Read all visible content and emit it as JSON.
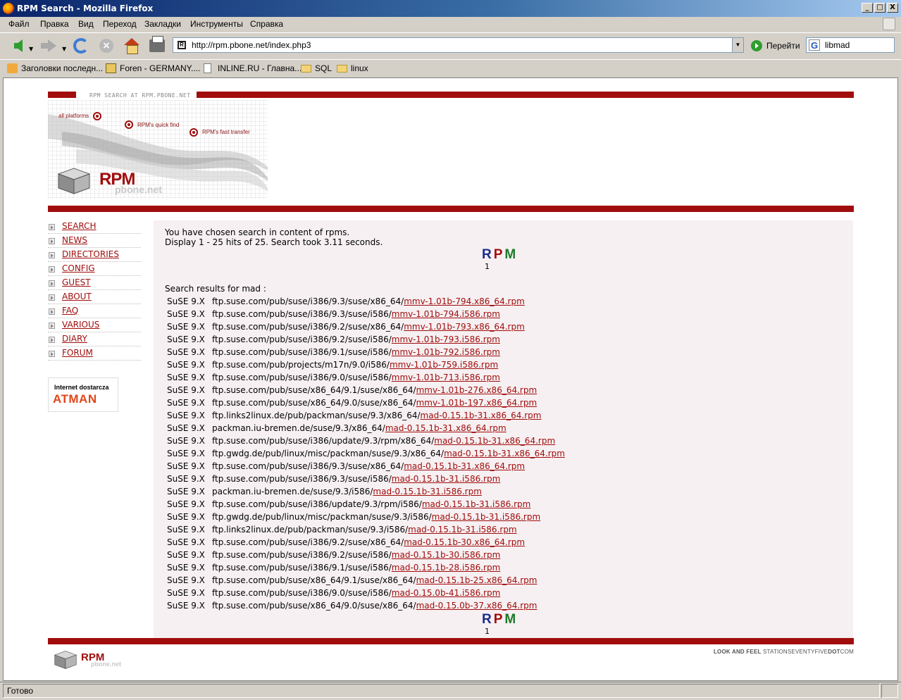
{
  "window": {
    "title": "RPM Search - Mozilla Firefox",
    "min": "_",
    "max": "□",
    "close": "X"
  },
  "menu": [
    "Файл",
    "Правка",
    "Вид",
    "Переход",
    "Закладки",
    "Инструменты",
    "Справка"
  ],
  "toolbar": {
    "url": "http://rpm.pbone.net/index.php3",
    "go_label": "Перейти",
    "search_value": "libmad"
  },
  "bookmarks": [
    {
      "label": "Заголовки последн...",
      "icon": "rss-icon"
    },
    {
      "label": "Foren - GERMANY....",
      "icon": "forum-icon"
    },
    {
      "label": "INLINE.RU - Главна...",
      "icon": "page-icon"
    },
    {
      "label": "SQL",
      "icon": "folder-icon"
    },
    {
      "label": "linux",
      "icon": "folder-icon"
    }
  ],
  "header": {
    "tagline": "RPM SEARCH AT RPM.PBONE.NET",
    "banner_labels": [
      "all platforms",
      "RPM's quick find",
      "RPM's fast transfer"
    ],
    "logo_rpm": "RPM",
    "logo_pbone": "pbone.net"
  },
  "nav": [
    "SEARCH",
    "NEWS",
    "DIRECTORIES",
    "CONFIG",
    "GUEST",
    "ABOUT",
    "FAQ",
    "VARIOUS",
    "DIARY",
    "FORUM"
  ],
  "sponsor": {
    "line1": "Internet dostarcza",
    "line2": "ATMAN"
  },
  "main": {
    "intro1": "You have chosen search in content of rpms.",
    "intro2": "Display 1 - 25 hits of 25. Search took 3.11 seconds.",
    "rpm_r": "R",
    "rpm_p": "P",
    "rpm_m": "M",
    "page": "1",
    "results_head": "Search results for mad :",
    "results": [
      {
        "dist": "SuSE 9.X",
        "path": "ftp.suse.com/pub/suse/i386/9.3/suse/x86_64/",
        "file": "mmv-1.01b-794.x86_64.rpm"
      },
      {
        "dist": "SuSE 9.X",
        "path": "ftp.suse.com/pub/suse/i386/9.3/suse/i586/",
        "file": "mmv-1.01b-794.i586.rpm"
      },
      {
        "dist": "SuSE 9.X",
        "path": "ftp.suse.com/pub/suse/i386/9.2/suse/x86_64/",
        "file": "mmv-1.01b-793.x86_64.rpm"
      },
      {
        "dist": "SuSE 9.X",
        "path": "ftp.suse.com/pub/suse/i386/9.2/suse/i586/",
        "file": "mmv-1.01b-793.i586.rpm"
      },
      {
        "dist": "SuSE 9.X",
        "path": "ftp.suse.com/pub/suse/i386/9.1/suse/i586/",
        "file": "mmv-1.01b-792.i586.rpm"
      },
      {
        "dist": "SuSE 9.X",
        "path": "ftp.suse.com/pub/projects/m17n/9.0/i586/",
        "file": "mmv-1.01b-759.i586.rpm"
      },
      {
        "dist": "SuSE 9.X",
        "path": "ftp.suse.com/pub/suse/i386/9.0/suse/i586/",
        "file": "mmv-1.01b-713.i586.rpm"
      },
      {
        "dist": "SuSE 9.X",
        "path": "ftp.suse.com/pub/suse/x86_64/9.1/suse/x86_64/",
        "file": "mmv-1.01b-276.x86_64.rpm"
      },
      {
        "dist": "SuSE 9.X",
        "path": "ftp.suse.com/pub/suse/x86_64/9.0/suse/x86_64/",
        "file": "mmv-1.01b-197.x86_64.rpm"
      },
      {
        "dist": "SuSE 9.X",
        "path": "ftp.links2linux.de/pub/packman/suse/9.3/x86_64/",
        "file": "mad-0.15.1b-31.x86_64.rpm"
      },
      {
        "dist": "SuSE 9.X",
        "path": "packman.iu-bremen.de/suse/9.3/x86_64/",
        "file": "mad-0.15.1b-31.x86_64.rpm"
      },
      {
        "dist": "SuSE 9.X",
        "path": "ftp.suse.com/pub/suse/i386/update/9.3/rpm/x86_64/",
        "file": "mad-0.15.1b-31.x86_64.rpm"
      },
      {
        "dist": "SuSE 9.X",
        "path": "ftp.gwdg.de/pub/linux/misc/packman/suse/9.3/x86_64/",
        "file": "mad-0.15.1b-31.x86_64.rpm"
      },
      {
        "dist": "SuSE 9.X",
        "path": "ftp.suse.com/pub/suse/i386/9.3/suse/x86_64/",
        "file": "mad-0.15.1b-31.x86_64.rpm"
      },
      {
        "dist": "SuSE 9.X",
        "path": "ftp.suse.com/pub/suse/i386/9.3/suse/i586/",
        "file": "mad-0.15.1b-31.i586.rpm"
      },
      {
        "dist": "SuSE 9.X",
        "path": "packman.iu-bremen.de/suse/9.3/i586/",
        "file": "mad-0.15.1b-31.i586.rpm"
      },
      {
        "dist": "SuSE 9.X",
        "path": "ftp.suse.com/pub/suse/i386/update/9.3/rpm/i586/",
        "file": "mad-0.15.1b-31.i586.rpm"
      },
      {
        "dist": "SuSE 9.X",
        "path": "ftp.gwdg.de/pub/linux/misc/packman/suse/9.3/i586/",
        "file": "mad-0.15.1b-31.i586.rpm"
      },
      {
        "dist": "SuSE 9.X",
        "path": "ftp.links2linux.de/pub/packman/suse/9.3/i586/",
        "file": "mad-0.15.1b-31.i586.rpm"
      },
      {
        "dist": "SuSE 9.X",
        "path": "ftp.suse.com/pub/suse/i386/9.2/suse/x86_64/",
        "file": "mad-0.15.1b-30.x86_64.rpm"
      },
      {
        "dist": "SuSE 9.X",
        "path": "ftp.suse.com/pub/suse/i386/9.2/suse/i586/",
        "file": "mad-0.15.1b-30.i586.rpm"
      },
      {
        "dist": "SuSE 9.X",
        "path": "ftp.suse.com/pub/suse/i386/9.1/suse/i586/",
        "file": "mad-0.15.1b-28.i586.rpm"
      },
      {
        "dist": "SuSE 9.X",
        "path": "ftp.suse.com/pub/suse/x86_64/9.1/suse/x86_64/",
        "file": "mad-0.15.1b-25.x86_64.rpm"
      },
      {
        "dist": "SuSE 9.X",
        "path": "ftp.suse.com/pub/suse/i386/9.0/suse/i586/",
        "file": "mad-0.15.0b-41.i586.rpm"
      },
      {
        "dist": "SuSE 9.X",
        "path": "ftp.suse.com/pub/suse/x86_64/9.0/suse/x86_64/",
        "file": "mad-0.15.0b-37.x86_64.rpm"
      }
    ]
  },
  "footer": {
    "logo_rpm": "RPM",
    "logo_pbone": "pbone.net",
    "credits_a": "LOOK AND FEEL",
    "credits_b": "STATIONSEVENTYFIVE",
    "credits_c": "DOT",
    "credits_d": "COM"
  },
  "status": {
    "text": "Готово"
  },
  "colors": {
    "brand_red": "#a10d0d",
    "link": "#a10d0d",
    "panel_bg": "#f6f0f2"
  }
}
